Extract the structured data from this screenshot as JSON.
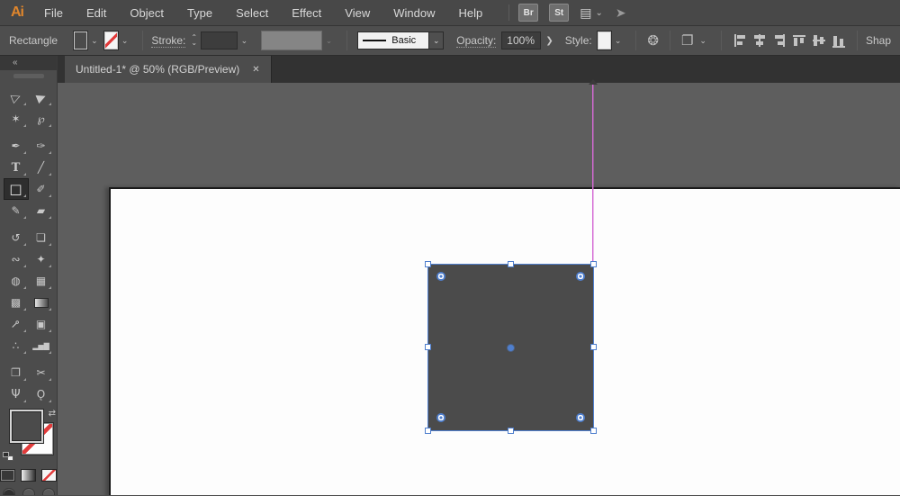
{
  "app_logo": "Ai",
  "menubar": {
    "menus": [
      "File",
      "Edit",
      "Object",
      "Type",
      "Select",
      "Effect",
      "View",
      "Window",
      "Help"
    ],
    "bridge_button": "Br",
    "stock_button": "St"
  },
  "icons": {
    "workspace": "▤",
    "chevron_down": "⌄",
    "stepper_up": "⌃",
    "stepper_down": "⌄",
    "share": "➤",
    "collapse": "«",
    "close_tab": "✕",
    "panel_arrow": "❯",
    "swap_fill_stroke": "⇄",
    "recolor_artwork": "❂",
    "document_setup": "❐"
  },
  "controlbar": {
    "context_label": "Rectangle",
    "stroke_label": "Stroke:",
    "stroke_value": "",
    "width_profile_value": "",
    "brush_definition": "Basic",
    "opacity_label": "Opacity:",
    "opacity_value": "100%",
    "style_label": "Style:",
    "shape_label": "Shap"
  },
  "document_tab": {
    "title": "Untitled-1* @ 50% (RGB/Preview)"
  },
  "tools": [
    {
      "name": "selection-tool",
      "glyph": "▷"
    },
    {
      "name": "direct-selection-tool",
      "glyph": "▶"
    },
    {
      "name": "magic-wand-tool",
      "glyph": "✶"
    },
    {
      "name": "lasso-tool",
      "glyph": "℘",
      "gap_after": true
    },
    {
      "name": "pen-tool",
      "glyph": "✒"
    },
    {
      "name": "curvature-tool",
      "glyph": "✑"
    },
    {
      "name": "type-tool",
      "glyph": "T"
    },
    {
      "name": "line-segment-tool",
      "glyph": "╱"
    },
    {
      "name": "rectangle-tool",
      "glyph": "□",
      "selected": true
    },
    {
      "name": "paintbrush-tool",
      "glyph": "✐"
    },
    {
      "name": "pencil-tool",
      "glyph": "✎"
    },
    {
      "name": "eraser-tool",
      "glyph": "▰",
      "gap_after": true
    },
    {
      "name": "rotate-tool",
      "glyph": "↺"
    },
    {
      "name": "scale-tool",
      "glyph": "❏"
    },
    {
      "name": "width-tool",
      "glyph": "∾"
    },
    {
      "name": "free-transform-tool",
      "glyph": "✦"
    },
    {
      "name": "shape-builder-tool",
      "glyph": "◍"
    },
    {
      "name": "perspective-grid-tool",
      "glyph": "▦"
    },
    {
      "name": "mesh-tool",
      "glyph": "▩"
    },
    {
      "name": "gradient-tool",
      "glyph": ""
    },
    {
      "name": "eyedropper-tool",
      "glyph": "⊸"
    },
    {
      "name": "blend-tool",
      "glyph": "▣"
    },
    {
      "name": "symbol-sprayer-tool",
      "glyph": "∴"
    },
    {
      "name": "column-graph-tool",
      "glyph": "▂▅▇",
      "gap_after": true
    },
    {
      "name": "artboard-tool",
      "glyph": "❐"
    },
    {
      "name": "slice-tool",
      "glyph": "✂"
    },
    {
      "name": "hand-tool",
      "glyph": "Ψ"
    },
    {
      "name": "zoom-tool",
      "glyph": "Ǫ"
    }
  ],
  "colors": {
    "selection_blue": "#4f7fce",
    "smart_guide_magenta": "#d46bd4",
    "object_fill_gray": "#4b4b4b",
    "logo_orange": "#e0862c",
    "none_swatch_red": "#e23b3b",
    "artboard_white": "#fdfdfd",
    "pasteboard_gray": "#5e5e5e"
  }
}
